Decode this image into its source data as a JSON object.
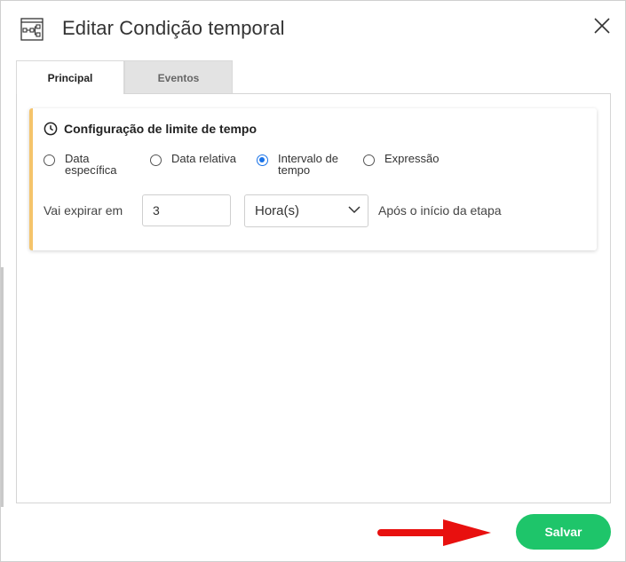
{
  "dialog": {
    "title": "Editar Condição temporal",
    "icon": "workflow-diagram-icon",
    "close_icon": "close-icon"
  },
  "tabs": [
    {
      "label": "Principal",
      "active": true
    },
    {
      "label": "Eventos",
      "active": false
    }
  ],
  "card": {
    "title": "Configuração de limite de tempo",
    "icon": "clock-icon",
    "accent_color": "#f5c46b"
  },
  "radio_options": [
    {
      "line1": "Data",
      "line2": "específica",
      "checked": false
    },
    {
      "line1": "Data relativa",
      "line2": "",
      "checked": false
    },
    {
      "line1": "Intervalo de",
      "line2": "tempo",
      "checked": true
    },
    {
      "line1": "Expressão",
      "line2": "",
      "checked": false
    }
  ],
  "expire": {
    "label": "Vai expirar em",
    "value": "3",
    "unit_selected": "Hora(s)",
    "after_text": "Após o início da etapa"
  },
  "footer": {
    "save_label": "Salvar",
    "save_color": "#1ec56a",
    "annotation": "red-arrow-icon",
    "arrow_color": "#e8100f"
  }
}
